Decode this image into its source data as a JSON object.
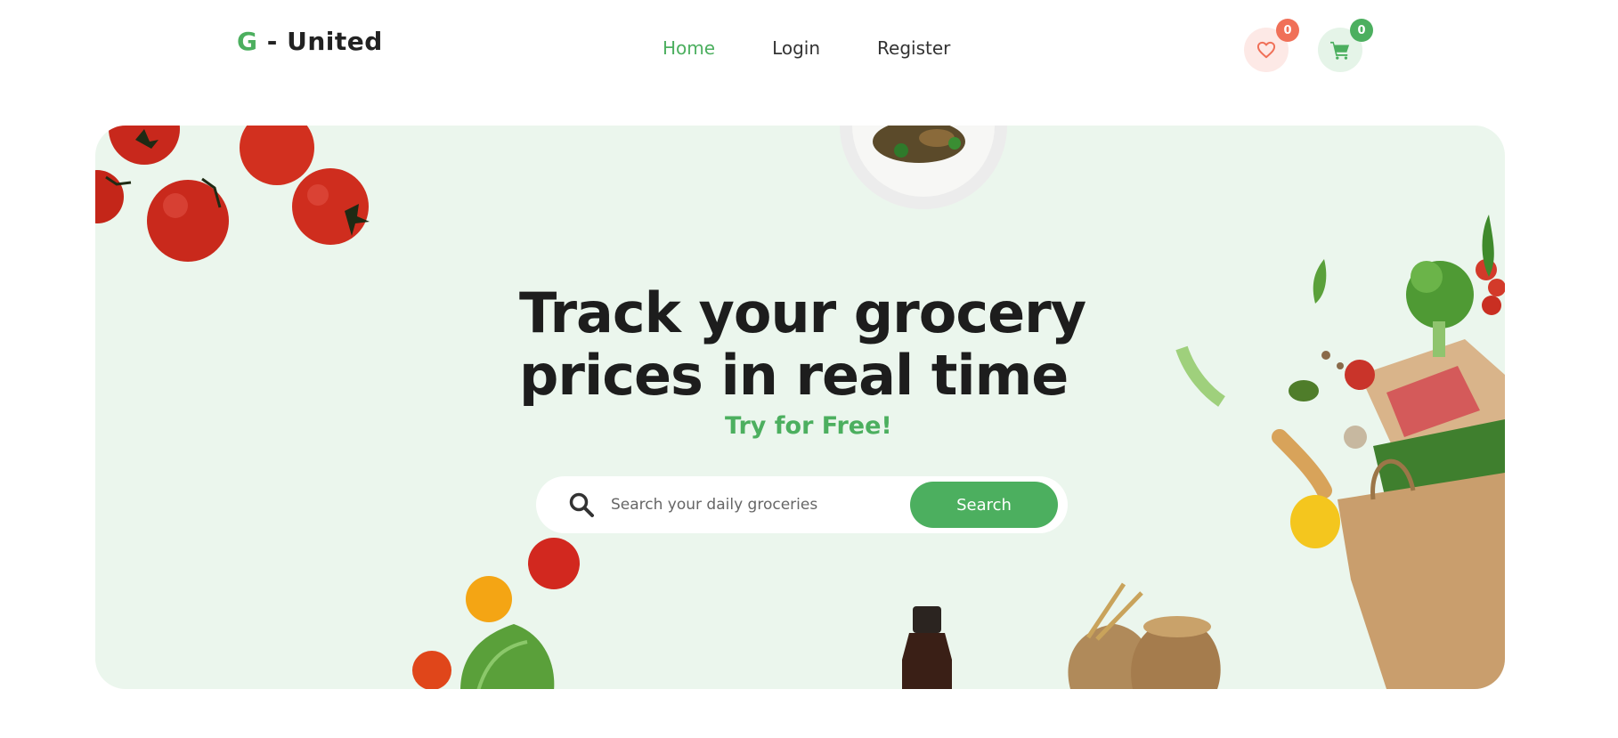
{
  "header": {
    "logo_letter": "G",
    "logo_rest": " - United",
    "nav": [
      {
        "label": "Home",
        "active": true
      },
      {
        "label": "Login",
        "active": false
      },
      {
        "label": "Register",
        "active": false
      }
    ],
    "wishlist": {
      "icon": "heart-icon",
      "count": "0"
    },
    "cart": {
      "icon": "cart-icon",
      "count": "0"
    }
  },
  "hero": {
    "headline_line1": "Track your grocery",
    "headline_line2": "prices in real time",
    "tagline": "Try for Free!",
    "search": {
      "placeholder": "Search your daily groceries",
      "button_label": "Search"
    }
  },
  "colors": {
    "accent": "#4caf5f",
    "hero_bg": "#ebf6ed",
    "wish_badge": "#f07058",
    "text": "#1d1d1d"
  }
}
